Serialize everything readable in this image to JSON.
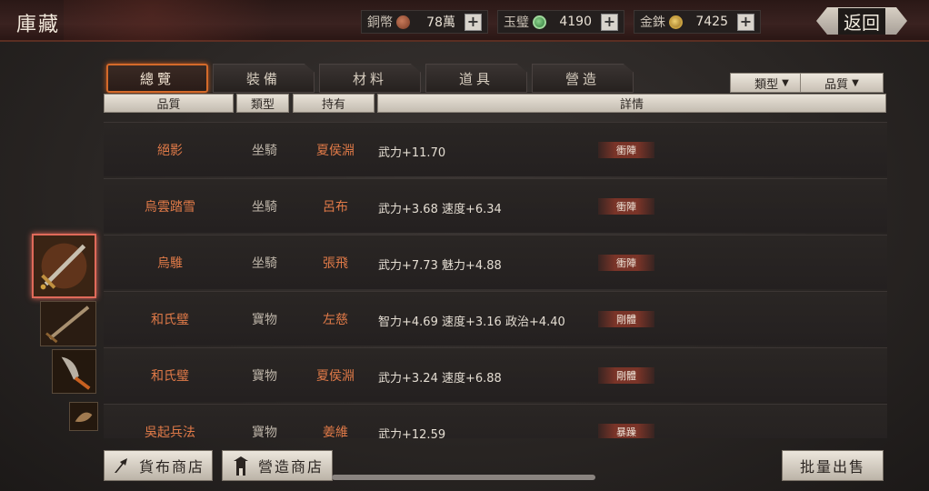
{
  "header": {
    "title": "庫藏",
    "back_label": "返回",
    "currencies": [
      {
        "name": "銅幣",
        "icon": "copper-coin-icon",
        "value": "78萬"
      },
      {
        "name": "玉璧",
        "icon": "jade-disc-icon",
        "value": "4190"
      },
      {
        "name": "金銖",
        "icon": "gold-coin-icon",
        "value": "7425"
      }
    ],
    "plus": "+"
  },
  "tabs": [
    {
      "label": "總覽",
      "active": true
    },
    {
      "label": "裝備",
      "active": false
    },
    {
      "label": "材料",
      "active": false
    },
    {
      "label": "道具",
      "active": false
    },
    {
      "label": "營造",
      "active": false
    }
  ],
  "filters": [
    {
      "label": "類型"
    },
    {
      "label": "品質"
    }
  ],
  "columns": [
    "品質",
    "類型",
    "持有",
    "詳情"
  ],
  "rows": [
    {
      "quality": "絕影",
      "type": "坐騎",
      "owner": "夏侯淵",
      "stats": "武力+11.70",
      "tag": "衝陣"
    },
    {
      "quality": "烏雲踏雪",
      "type": "坐騎",
      "owner": "呂布",
      "stats": "武力+3.68  速度+6.34",
      "tag": "衝陣"
    },
    {
      "quality": "烏騅",
      "type": "坐騎",
      "owner": "張飛",
      "stats": "武力+7.73  魅力+4.88",
      "tag": "衝陣"
    },
    {
      "quality": "和氏璧",
      "type": "寶物",
      "owner": "左慈",
      "stats": "智力+4.69  速度+3.16  政治+4.40",
      "tag": "剛體"
    },
    {
      "quality": "和氏璧",
      "type": "寶物",
      "owner": "夏侯淵",
      "stats": "武力+3.24  速度+6.88",
      "tag": "剛體"
    },
    {
      "quality": "吳起兵法",
      "type": "寶物",
      "owner": "姜維",
      "stats": "武力+12.59",
      "tag": "暴躁"
    }
  ],
  "bottom": {
    "cloth_shop": "貨布商店",
    "build_shop": "營造商店",
    "bulk_sell": "批量出售"
  }
}
